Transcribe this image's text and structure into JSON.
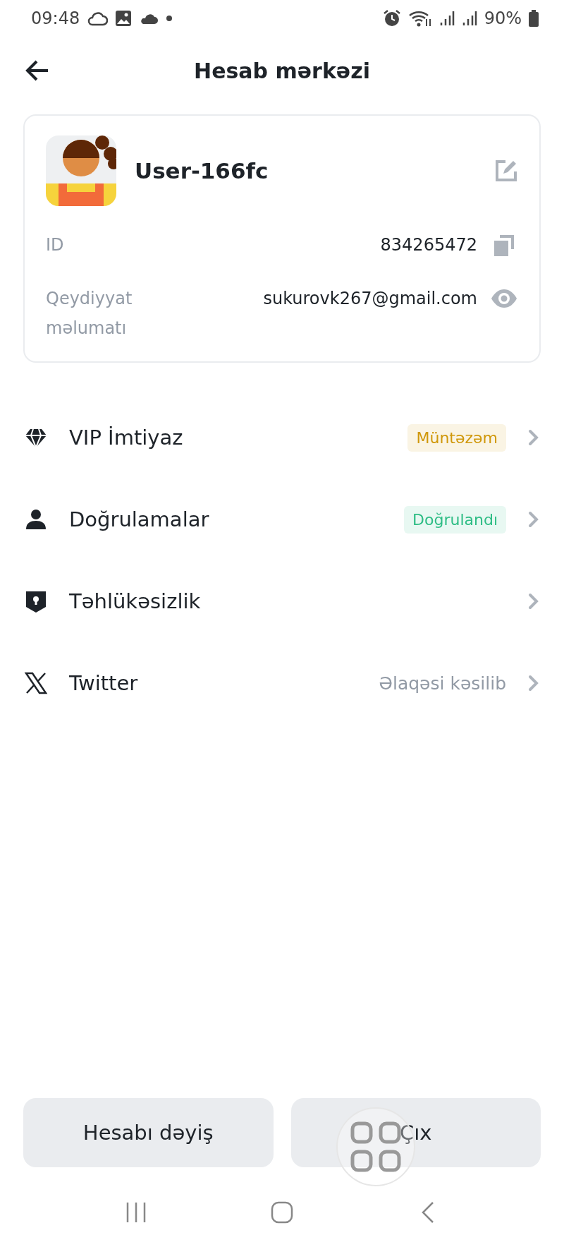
{
  "status_bar": {
    "time": "09:48",
    "battery": "90%"
  },
  "header": {
    "title": "Hesab mərkəzi"
  },
  "profile": {
    "name": "User-166fc",
    "fields": [
      {
        "kind": "copy",
        "label": "ID",
        "value": "834265472"
      },
      {
        "kind": "reveal",
        "label": "Qeydiyyat məlumatı",
        "value": "sukurovk267@gmail.com"
      }
    ]
  },
  "menu": [
    {
      "kind": "diamond",
      "label": "VIP İmtiyaz",
      "status": "Müntəzəm",
      "color": "#d0980b",
      "highlighted": true
    },
    {
      "kind": "person",
      "label": "Doğrulamalar",
      "status": "Doğrulandı",
      "color": "#2ebd85",
      "highlighted": true
    },
    {
      "kind": "shield",
      "label": "Təhlükəsizlik"
    },
    {
      "kind": "x",
      "label": "Twitter",
      "status": "Əlaqəsi kəsilib",
      "color": "#929aa5",
      "highlighted": false
    }
  ],
  "buttons": [
    "Hesabı dəyiş",
    "Çıx"
  ]
}
